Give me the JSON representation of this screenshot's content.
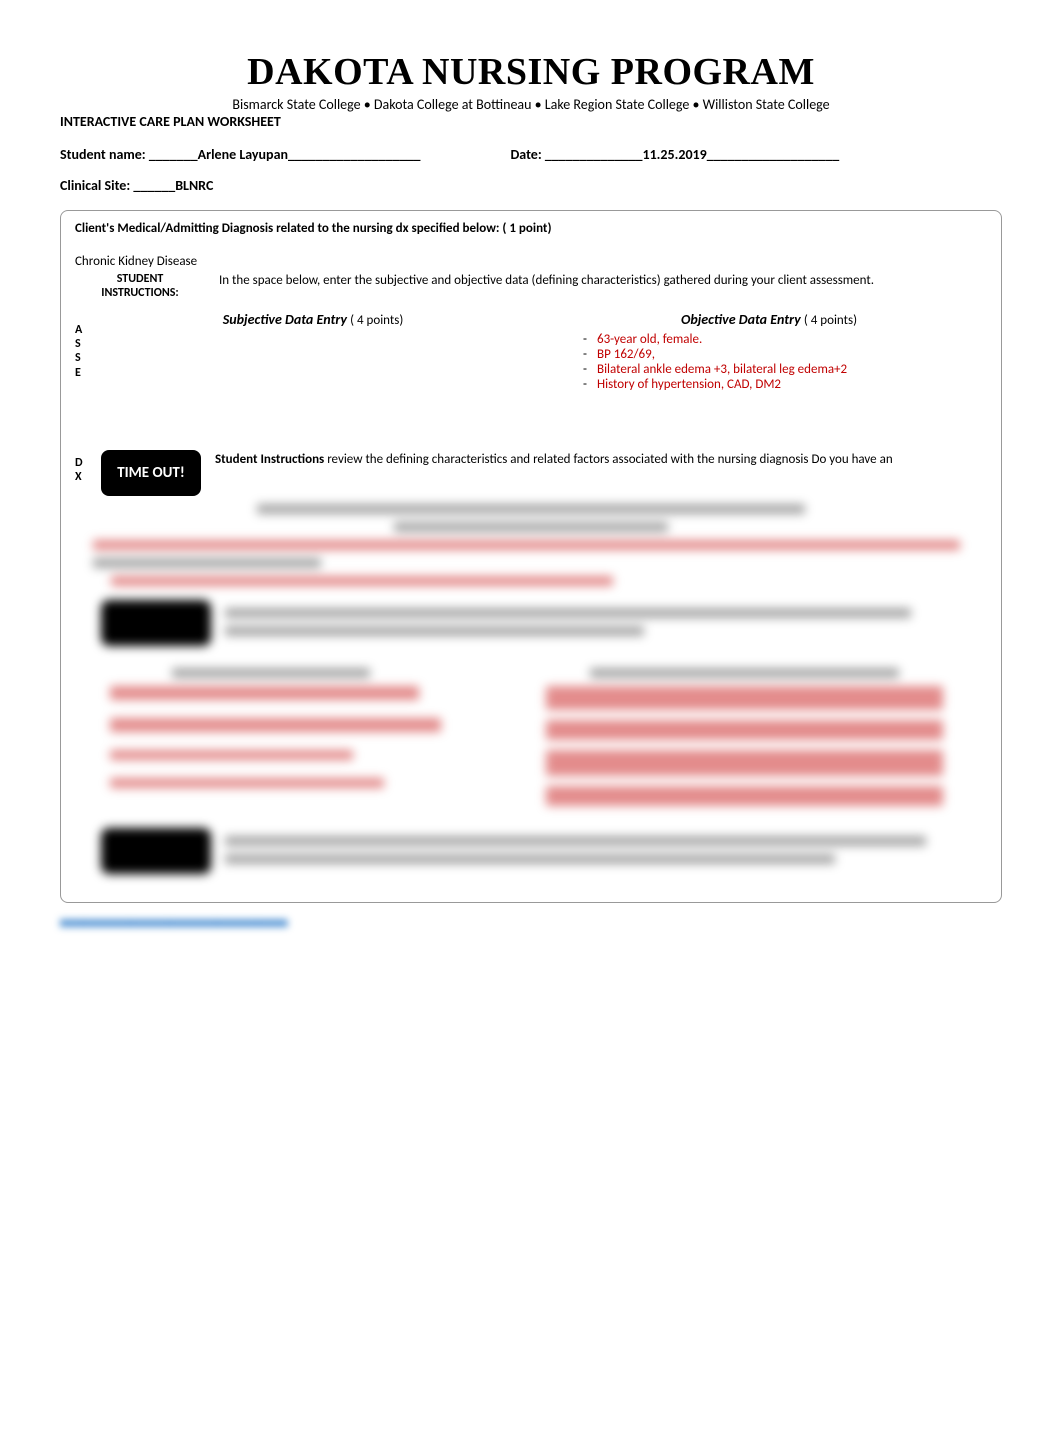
{
  "header": {
    "title": "DAKOTA NURSING PROGRAM",
    "subtitle": "Bismarck State College • Dakota College at Bottineau • Lake Region State College • Williston State College",
    "worksheet": "INTERACTIVE CARE PLAN WORKSHEET"
  },
  "student": {
    "name_label": "Student name: ",
    "name_pre": "_______",
    "name_value": "Arlene Layupan",
    "name_post": "___________________",
    "date_label": "Date: ",
    "date_pre": "______________",
    "date_value": "11.25.2019",
    "date_post": "___________________",
    "site_label": "Clinical Site: ",
    "site_pre": "______",
    "site_value": "BLNRC"
  },
  "diagnosis": {
    "label": "Client's Medical/Admitting Diagnosis related to the nursing dx specified below: ( 1 point)",
    "value": "Chronic Kidney Disease"
  },
  "instructions": {
    "label1": "STUDENT",
    "label2": "INSTRUCTIONS:",
    "text": "In the space below, enter the subjective and objective data (defining characteristics) gathered during your client assessment."
  },
  "asse_letters": [
    "A",
    "S",
    "S",
    "E"
  ],
  "subjective": {
    "heading": "Subjective Data Entry",
    "points": "( 4 points)"
  },
  "objective": {
    "heading": "Objective Data Entry",
    "points": "( 4 points)",
    "items": [
      "63-year old, female.",
      "BP 162/69,",
      "Bilateral ankle edema +3, bilateral leg edema+2",
      "History of hypertension, CAD, DM2"
    ]
  },
  "dx_letters": [
    "D",
    "X"
  ],
  "timeout": "TIME OUT!",
  "dx_instructions": {
    "bold": "Student Instructions ",
    "rest": "review the defining characteristics and related factors associated with the nursing diagnosis   Do you have an"
  }
}
